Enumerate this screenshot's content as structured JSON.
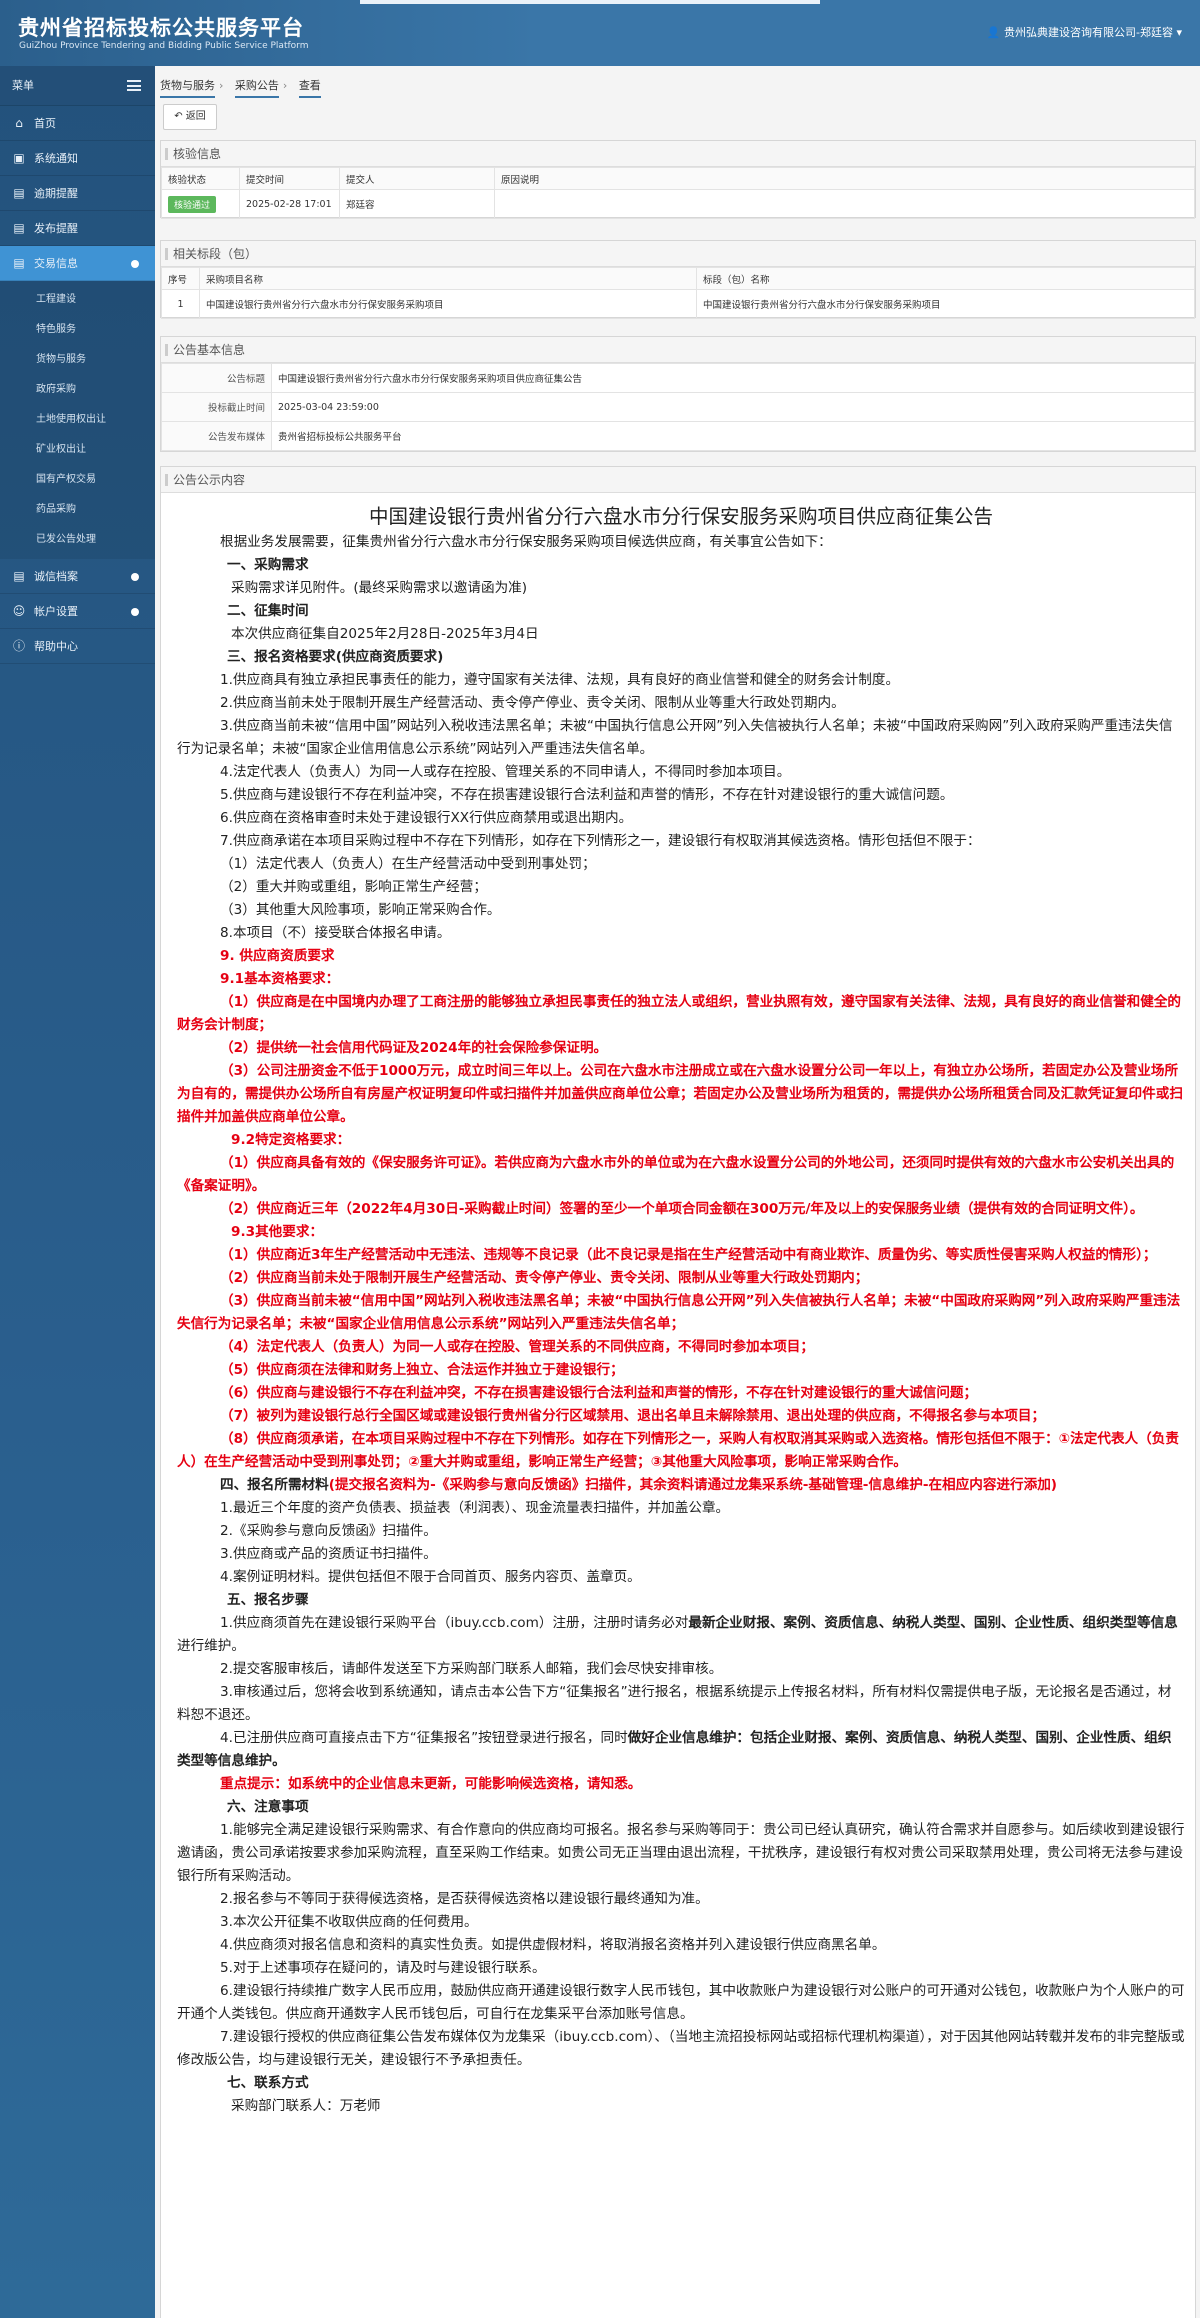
{
  "header": {
    "title": "贵州省招标投标公共服务平台",
    "subtitle": "GuiZhou Province Tendering and Bidding Public Service Platform",
    "user": "贵州弘典建设咨询有限公司-郑廷容"
  },
  "sidebar": {
    "menu_label": "菜单",
    "items": [
      {
        "label": "首页",
        "icon": "home-icon"
      },
      {
        "label": "系统通知",
        "icon": "monitor-icon"
      },
      {
        "label": "逾期提醒",
        "icon": "inbox-icon"
      },
      {
        "label": "发布提醒",
        "icon": "inbox-icon"
      },
      {
        "label": "交易信息",
        "icon": "inbox-icon"
      }
    ],
    "sub_items": [
      "工程建设",
      "特色服务",
      "货物与服务",
      "政府采购",
      "土地使用权出让",
      "矿业权出让",
      "国有产权交易",
      "药品采购",
      "已发公告处理"
    ],
    "items_after": [
      {
        "label": "诚信档案",
        "icon": "list-icon"
      },
      {
        "label": "帐户设置",
        "icon": "user-icon"
      },
      {
        "label": "帮助中心",
        "icon": "help-icon"
      }
    ]
  },
  "breadcrumb": [
    "货物与服务",
    "采购公告",
    "查看"
  ],
  "back_label": "返回",
  "check_info": {
    "title": "核验信息",
    "headers": [
      "核验状态",
      "提交时间",
      "提交人",
      "原因说明"
    ],
    "row": {
      "status": "核验通过",
      "time": "2025-02-28 17:01",
      "submitter": "郑廷容",
      "reason": ""
    }
  },
  "related": {
    "title": "相关标段（包）",
    "headers": [
      "序号",
      "采购项目名称",
      "标段（包）名称"
    ],
    "row": {
      "no": "1",
      "project": "中国建设银行贵州省分行六盘水市分行保安服务采购项目",
      "section": "中国建设银行贵州省分行六盘水市分行保安服务采购项目"
    }
  },
  "basic": {
    "title": "公告基本信息",
    "rows": [
      {
        "k": "公告标题",
        "v": "中国建设银行贵州省分行六盘水市分行保安服务采购项目供应商征集公告"
      },
      {
        "k": "投标截止时间",
        "v": "2025-03-04 23:59:00"
      },
      {
        "k": "公告发布媒体",
        "v": "贵州省招标投标公共服务平台"
      }
    ]
  },
  "notice": {
    "section_title": "公告公示内容",
    "doc_title": "中国建设银行贵州省分行六盘水市分行保安服务采购项目供应商征集公告",
    "lines": {
      "l01": "根据业务发展需要，征集贵州省分行六盘水市分行保安服务采购项目候选供应商，有关事宜公告如下：",
      "l02": "一、采购需求",
      "l03": "采购需求详见附件。(最终采购需求以邀请函为准)",
      "l04": "二、征集时间",
      "l05": "本次供应商征集自2025年2月28日-2025年3月4日",
      "l06": "三、报名资格要求(供应商资质要求)",
      "l07": "1.供应商具有独立承担民事责任的能力，遵守国家有关法律、法规，具有良好的商业信誉和健全的财务会计制度。",
      "l08": "2.供应商当前未处于限制开展生产经营活动、责令停产停业、责令关闭、限制从业等重大行政处罚期内。",
      "l09": "3.供应商当前未被“信用中国”网站列入税收违法黑名单；未被“中国执行信息公开网”列入失信被执行人名单；未被“中国政府采购网”列入政府采购严重违法失信行为记录名单；未被“国家企业信用信息公示系统”网站列入严重违法失信名单。",
      "l10": "4.法定代表人（负责人）为同一人或存在控股、管理关系的不同申请人，不得同时参加本项目。",
      "l11": "5.供应商与建设银行不存在利益冲突，不存在损害建设银行合法利益和声誉的情形，不存在针对建设银行的重大诚信问题。",
      "l12": "6.供应商在资格审查时未处于建设银行XX行供应商禁用或退出期内。",
      "l13": "7.供应商承诺在本项目采购过程中不存在下列情形，如存在下列情形之一，建设银行有权取消其候选资格。情形包括但不限于：",
      "l14": "（1）法定代表人（负责人）在生产经营活动中受到刑事处罚；",
      "l15": "（2）重大并购或重组，影响正常生产经营；",
      "l16": "（3）其他重大风险事项，影响正常采购合作。",
      "l17": "8.本项目（不）接受联合体报名申请。",
      "l18": "9. 供应商资质要求",
      "l19": "9.1基本资格要求：",
      "l20": "（1）供应商是在中国境内办理了工商注册的能够独立承担民事责任的独立法人或组织，营业执照有效，遵守国家有关法律、法规，具有良好的商业信誉和健全的财务会计制度；",
      "l21": "（2）提供统一社会信用代码证及2024年的社会保险参保证明。",
      "l22": "（3）公司注册资金不低于1000万元，成立时间三年以上。公司在六盘水市注册成立或在六盘水设置分公司一年以上，有独立办公场所，若固定办公及营业场所为自有的，需提供办公场所自有房屋产权证明复印件或扫描件并加盖供应商单位公章；若固定办公及营业场所为租赁的，需提供办公场所租赁合同及汇款凭证复印件或扫描件并加盖供应商单位公章。",
      "l23": "9.2特定资格要求：",
      "l24": "（1）供应商具备有效的《保安服务许可证》。若供应商为六盘水市外的单位或为在六盘水设置分公司的外地公司，还须同时提供有效的六盘水市公安机关出具的《备案证明》。",
      "l25": "（2）供应商近三年（2022年4月30日-采购截止时间）签署的至少一个单项合同金额在300万元/年及以上的安保服务业绩（提供有效的合同证明文件）。",
      "l26": "9.3其他要求：",
      "l27": "（1）供应商近3年生产经营活动中无违法、违规等不良记录（此不良记录是指在生产经营活动中有商业欺诈、质量伪劣、等实质性侵害采购人权益的情形）；",
      "l28": "（2）供应商当前未处于限制开展生产经营活动、责令停产停业、责令关闭、限制从业等重大行政处罚期内；",
      "l29": "（3）供应商当前未被“信用中国”网站列入税收违法黑名单；未被“中国执行信息公开网”列入失信被执行人名单；未被“中国政府采购网”列入政府采购严重违法失信行为记录名单；未被“国家企业信用信息公示系统”网站列入严重违法失信名单；",
      "l30": "（4）法定代表人（负责人）为同一人或存在控股、管理关系的不同供应商，不得同时参加本项目；",
      "l31": "（5）供应商须在法律和财务上独立、合法运作并独立于建设银行；",
      "l32": "（6）供应商与建设银行不存在利益冲突，不存在损害建设银行合法利益和声誉的情形，不存在针对建设银行的重大诚信问题；",
      "l33": "（7）被列为建设银行总行全国区域或建设银行贵州省分行区域禁用、退出名单且未解除禁用、退出处理的供应商，不得报名参与本项目；",
      "l34": "（8）供应商须承诺，在本项目采购过程中不存在下列情形。如存在下列情形之一，采购人有权取消其采购或入选资格。情形包括但不限于：①法定代表人（负责人）在生产经营活动中受到刑事处罚；②重大并购或重组，影响正常生产经营；③其他重大风险事项，影响正常采购合作。",
      "l35a": "四、报名所需材料",
      "l35b": "(提交报名资料为-《采购参与意向反馈函》扫描件，其余资料请通过龙集采系统-基础管理-信息维护-在相应内容进行添加)",
      "l36": "1.最近三个年度的资产负债表、损益表（利润表）、现金流量表扫描件，并加盖公章。",
      "l37": "2.《采购参与意向反馈函》扫描件。",
      "l38": "3.供应商或产品的资质证书扫描件。",
      "l39": "4.案例证明材料。提供包括但不限于合同首页、服务内容页、盖章页。",
      "l40": "五、报名步骤",
      "l41a": "1.供应商须首先在建设银行采购平台（ibuy.ccb.com）注册，注册时请务必对",
      "l41b": "最新企业财报、案例、资质信息、纳税人类型、国别、企业性质、组织类型等信息",
      "l41c": "进行维护。",
      "l42": "2.提交客服审核后，请邮件发送至下方采购部门联系人邮箱，我们会尽快安排审核。",
      "l43": "3.审核通过后，您将会收到系统通知，请点击本公告下方“征集报名”进行报名，根据系统提示上传报名材料，所有材料仅需提供电子版，无论报名是否通过，材料恕不退还。",
      "l44a": "4.已注册供应商可直接点击下方“征集报名”按钮登录进行报名，同时",
      "l44b": "做好企业信息维护：包括企业财报、案例、资质信息、纳税人类型、国别、企业性质、组织类型等信息维护。",
      "l45": "重点提示：如系统中的企业信息未更新，可能影响候选资格，请知悉。",
      "l46": "六、注意事项",
      "l47": "1.能够完全满足建设银行采购需求、有合作意向的供应商均可报名。报名参与采购等同于：贵公司已经认真研究，确认符合需求并自愿参与。如后续收到建设银行邀请函，贵公司承诺按要求参加采购流程，直至采购工作结束。如贵公司无正当理由退出流程，干扰秩序，建设银行有权对贵公司采取禁用处理，贵公司将无法参与建设银行所有采购活动。",
      "l48": "2.报名参与不等同于获得候选资格，是否获得候选资格以建设银行最终通知为准。",
      "l49": "3.本次公开征集不收取供应商的任何费用。",
      "l50": "4.供应商须对报名信息和资料的真实性负责。如提供虚假材料，将取消报名资格并列入建设银行供应商黑名单。",
      "l51": "5.对于上述事项存在疑问的，请及时与建设银行联系。",
      "l52": "6.建设银行持续推广数字人民币应用，鼓励供应商开通建设银行数字人民币钱包，其中收款账户为建设银行对公账户的可开通对公钱包，收款账户为个人账户的可开通个人类钱包。供应商开通数字人民币钱包后，可自行在龙集采平台添加账号信息。",
      "l53": "7.建设银行授权的供应商征集公告发布媒体仅为龙集采（ibuy.ccb.com）、（当地主流招投标网站或招标代理机构渠道），对于因其他网站转载并发布的非完整版或修改版公告，均与建设银行无关，建设银行不予承担责任。",
      "l54": "七、联系方式",
      "l55": "采购部门联系人：万老师"
    }
  },
  "colors": {
    "header": "#3a76a8",
    "sidebar": "#2a5f8e",
    "active": "#3f93d4",
    "red": "#e60012",
    "badge": "#5cb85c"
  }
}
